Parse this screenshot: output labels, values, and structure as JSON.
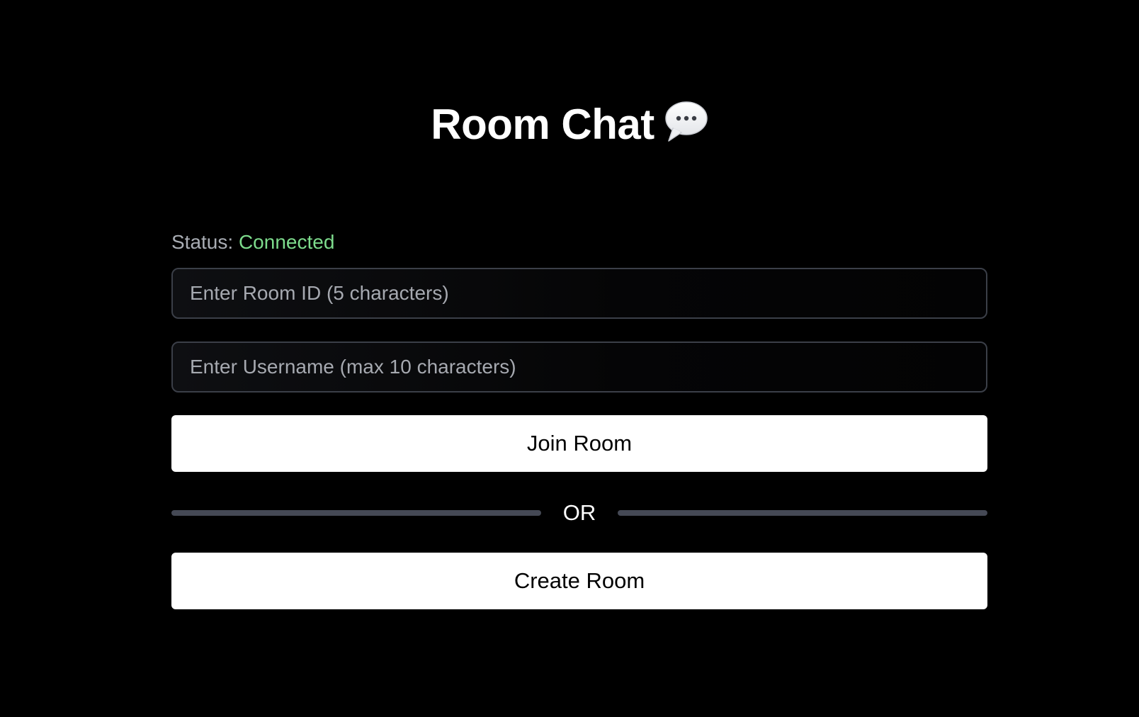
{
  "header": {
    "title": "Room Chat",
    "icon": "speech-bubble-icon"
  },
  "status": {
    "label": "Status:",
    "value": "Connected",
    "value_color": "#7ddb8c"
  },
  "form": {
    "room_id_placeholder": "Enter Room ID (5 characters)",
    "room_id_value": "",
    "username_placeholder": "Enter Username (max 10 characters)",
    "username_value": "",
    "join_label": "Join Room",
    "divider_label": "OR",
    "create_label": "Create Room"
  },
  "colors": {
    "background": "#000000",
    "button_background": "#ffffff",
    "divider": "#454955",
    "field_border": "#3b3f48"
  }
}
